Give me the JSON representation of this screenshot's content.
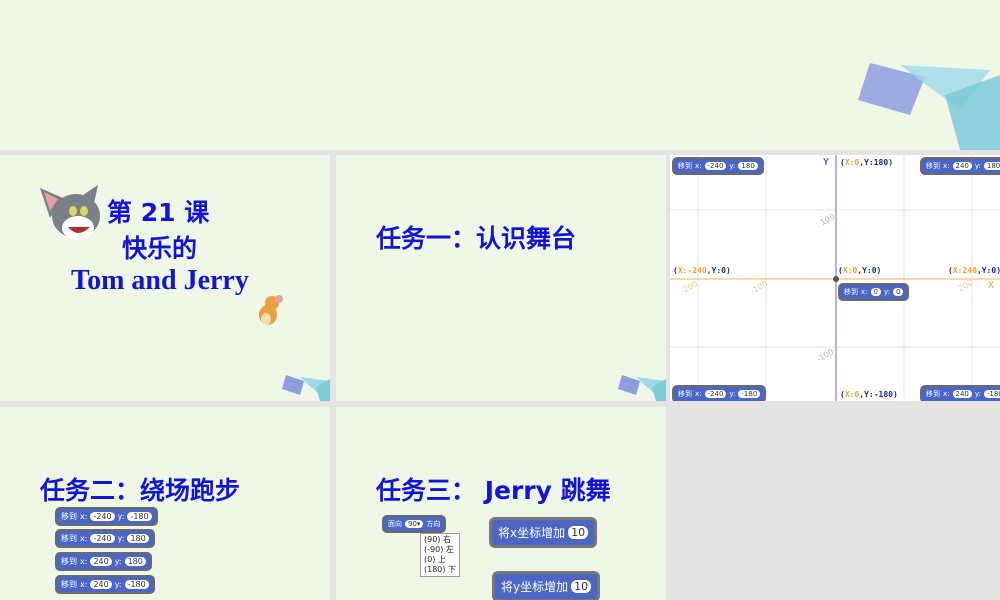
{
  "slide1": {
    "line1": "第 21 课",
    "line2": "快乐的",
    "line3": "Tom and Jerry"
  },
  "slide2": {
    "title": "任务一：认识舞台"
  },
  "slide3": {
    "axis_x": "X",
    "axis_y": "Y",
    "labels": {
      "top": [
        "X:0",
        ",Y:180"
      ],
      "bottom": [
        "X:0",
        ",Y:-180"
      ],
      "left": [
        "X:-240",
        ",Y:0"
      ],
      "right": [
        "X:240",
        ",Y:0"
      ],
      "center": [
        "X:0",
        ",Y:0"
      ]
    },
    "ticks": {
      "x": [
        "-200",
        "-100",
        "200"
      ],
      "y": [
        "100",
        "-100"
      ]
    },
    "goto_label": "移到",
    "x_label": "x:",
    "y_label": "y:",
    "blocks": [
      {
        "x": "-240",
        "y": "180"
      },
      {
        "x": "240",
        "y": "180"
      },
      {
        "x": "0",
        "y": "0"
      },
      {
        "x": "-240",
        "y": "-180"
      },
      {
        "x": "240",
        "y": "-180"
      }
    ]
  },
  "slide4": {
    "title": "任务二：绕场跑步",
    "goto_label": "移到",
    "x_label": "x:",
    "y_label": "y:",
    "blocks": [
      {
        "x": "-240",
        "y": "-180"
      },
      {
        "x": "-240",
        "y": "180"
      },
      {
        "x": "240",
        "y": "180"
      },
      {
        "x": "240",
        "y": "-180"
      }
    ]
  },
  "slide5": {
    "title": "任务三： Jerry  跳舞",
    "point_label": "面向",
    "point_value": "90▾",
    "point_suffix": "方向",
    "options": [
      "(90)  右",
      "(-90)  左",
      "(0)  上",
      "(180)  下"
    ],
    "change_x": "将x坐标增加",
    "change_x_val": "10",
    "change_y": "将y坐标增加",
    "change_y_val": "10"
  },
  "colors": {
    "title": "#1414d8",
    "slide_bg": "#eff7e6",
    "block": "#4c66c6"
  }
}
